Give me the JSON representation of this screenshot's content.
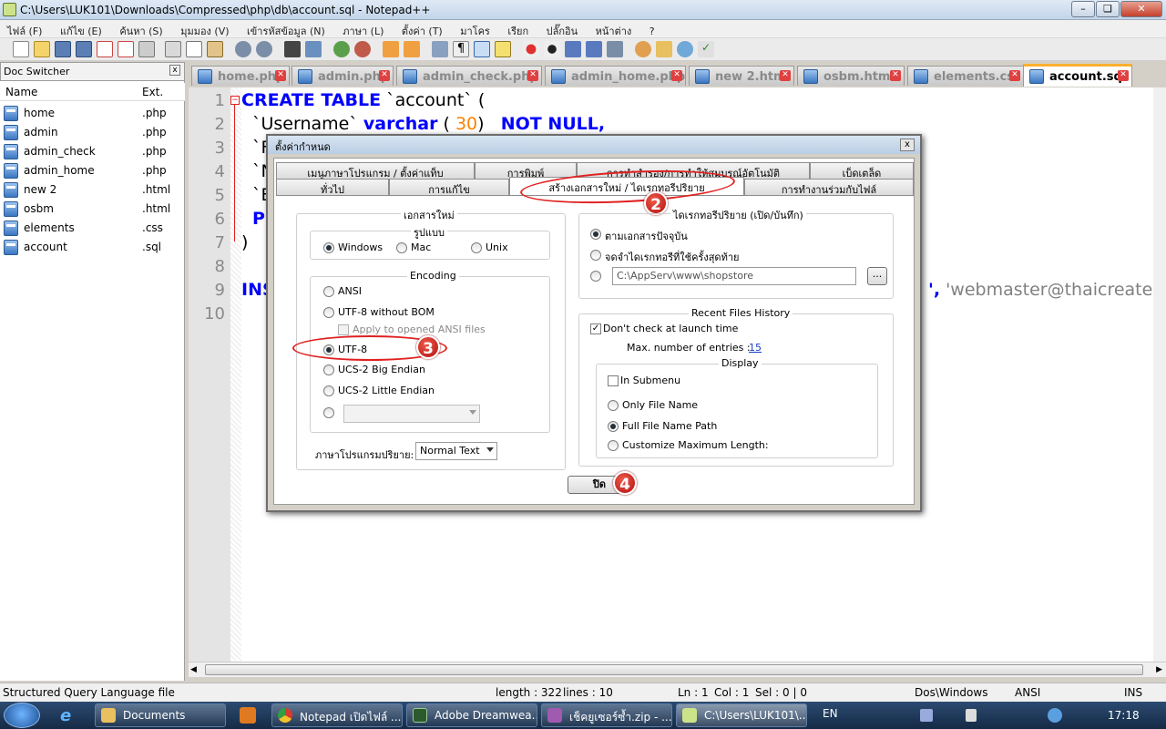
{
  "window": {
    "title": "C:\\Users\\LUK101\\Downloads\\Compressed\\php\\db\\account.sql - Notepad++",
    "min": "0",
    "max": "1",
    "close": "r"
  },
  "menu": [
    "ไฟล์ (F)",
    "แก้ไข (E)",
    "ค้นหา (S)",
    "มุมมอง (V)",
    "เข้ารหัสข้อมูล (N)",
    "ภาษา (L)",
    "ตั้งค่า (T)",
    "มาโคร",
    "เรียก",
    "ปลั๊กอิน",
    "หน้าต่าง",
    "?"
  ],
  "doc_switcher": {
    "title": "Doc Switcher",
    "close": "x",
    "col_name": "Name",
    "col_ext": "Ext.",
    "files": [
      {
        "name": "home",
        "ext": ".php"
      },
      {
        "name": "admin",
        "ext": ".php"
      },
      {
        "name": "admin_check",
        "ext": ".php"
      },
      {
        "name": "admin_home",
        "ext": ".php"
      },
      {
        "name": "new  2",
        "ext": ".html"
      },
      {
        "name": "osbm",
        "ext": ".html"
      },
      {
        "name": "elements",
        "ext": ".css"
      },
      {
        "name": "account",
        "ext": ".sql"
      }
    ]
  },
  "tabs": [
    "home.php",
    "admin.php",
    "admin_check.php",
    "admin_home.php",
    "new  2.html",
    "osbm.html",
    "elements.css",
    "account.sql"
  ],
  "editor": {
    "line_numbers": [
      "1",
      "2",
      "3",
      "4",
      "5",
      "6",
      "7",
      "8",
      "9",
      "10"
    ],
    "line1": {
      "kw": "CREATE TABLE",
      "rest": " `account`  ("
    },
    "line2": {
      "name": "`Username`",
      "type": "varchar",
      "open": " (",
      "num": "30",
      "close": ")",
      "kw": "NOT NULL,"
    },
    "line3": "`F",
    "line4": "`N",
    "line5": "`E",
    "line6": "P",
    "line7": ")",
    "line9_kw": "INS",
    "line9_tail": {
      "comma": "',",
      "str": " 'webmaster@thaicreate.co"
    }
  },
  "dialog": {
    "title": "ตั้งค่ากำหนด",
    "close": "x",
    "tabs_row1": [
      "เมนูภาษาโปรแกรม / ตั้งค่าแท็บ",
      "การพิมพ์",
      "การทำสำรอง/การทำให้สมบูรณ์อัตโนมัติ",
      "เบ็ดเตล็ด"
    ],
    "tabs_row2": [
      "ทั่วไป",
      "การแก้ไข",
      "สร้างเอกสารใหม่ / ไดเรกทอรีปริยาย",
      "การทำงานร่วมกับไฟล์"
    ],
    "new_doc": {
      "title": "เอกสารใหม่",
      "format_title": "รูปแบบ",
      "formats": [
        "Windows",
        "Mac",
        "Unix"
      ],
      "encoding_title": "Encoding",
      "encodings": [
        "ANSI",
        "UTF-8 without BOM",
        "UTF-8",
        "UCS-2 Big Endian",
        "UCS-2 Little Endian"
      ],
      "apply_ansi": "Apply to opened ANSI files",
      "lang_label": "ภาษาโปรแกรมปริยาย:",
      "lang_value": "Normal Text"
    },
    "default_dir": {
      "title": "ไดเรกทอรีปริยาย (เปิด/บันทึก)",
      "opt1": "ตามเอกสารปัจจุบัน",
      "opt2": "จดจำไดเรกทอรีที่ใช้ครั้งสุดท้าย",
      "path": "C:\\AppServ\\www\\shopstore",
      "browse": "..."
    },
    "recent": {
      "title": "Recent Files History",
      "dont_check": "Don't check at launch time",
      "max_label": "Max. number of entries :",
      "max_value": "15",
      "display_title": "Display",
      "in_submenu": "In Submenu",
      "only_name": "Only File Name",
      "full_path": "Full File Name Path",
      "customize": "Customize Maximum Length:"
    },
    "close_btn": "ปิด",
    "badges": [
      "2",
      "3",
      "4"
    ]
  },
  "status": {
    "lang": "Structured Query Language file",
    "length": "length : 322",
    "lines": "lines : 10",
    "ln": "Ln : 1",
    "col": "Col : 1",
    "sel": "Sel : 0 | 0",
    "eol": "Dos\\Windows",
    "enc": "ANSI",
    "ins": "INS"
  },
  "taskbar": {
    "items": [
      "Documents",
      "Notepad เปิดไฟล์ ...",
      "Adobe Dreamwea...",
      "เช็คยูเซอร์ซ้ำ.zip - ...",
      "C:\\Users\\LUK101\\..."
    ],
    "lang": "EN",
    "time": "17:18"
  },
  "colors": {
    "keyword": "#0000ff",
    "number": "#ff8000",
    "annotation": "#e02020",
    "taskbar": "#1f3a5e"
  }
}
